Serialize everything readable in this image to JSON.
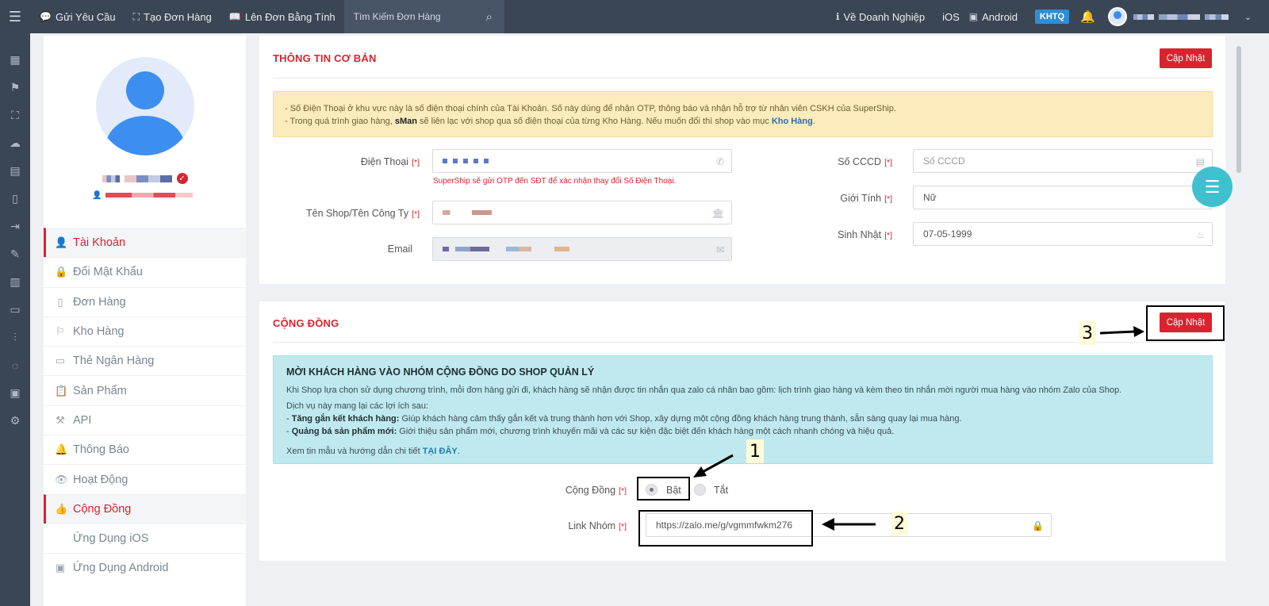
{
  "topbar": {
    "links": [
      {
        "icon": "chat-icon",
        "label": "Gửi Yêu Cầu"
      },
      {
        "icon": "scan-icon",
        "label": "Tạo Đơn Hàng"
      },
      {
        "icon": "book-icon",
        "label": "Lên Đơn Bằng Tính"
      }
    ],
    "search_placeholder": "Tìm Kiếm Đơn Hàng",
    "right_links": [
      {
        "icon": "info-icon",
        "label": "Về Doanh Nghiệp"
      },
      {
        "icon": "apple-icon",
        "label": "iOS"
      },
      {
        "icon": "android-icon",
        "label": "Android"
      }
    ],
    "badge": "KHTQ"
  },
  "sidebar": {
    "items": [
      {
        "icon": "user-icon",
        "label": "Tài Khoản",
        "active": true
      },
      {
        "icon": "lock-icon",
        "label": "Đổi Mật Khẩu"
      },
      {
        "icon": "book-icon",
        "label": "Đơn Hàng"
      },
      {
        "icon": "signpost-icon",
        "label": "Kho Hàng"
      },
      {
        "icon": "card-icon",
        "label": "Thẻ Ngân Hàng"
      },
      {
        "icon": "clipboard-icon",
        "label": "Sản Phẩm"
      },
      {
        "icon": "wand-icon",
        "label": "API"
      },
      {
        "icon": "bell-icon",
        "label": "Thông Báo"
      },
      {
        "icon": "eye-icon",
        "label": "Hoạt Động"
      },
      {
        "icon": "thumbs-up-icon",
        "label": "Cộng Đồng",
        "active": true
      },
      {
        "icon": "apple-icon",
        "label": "Ứng Dụng iOS"
      },
      {
        "icon": "android-icon",
        "label": "Ứng Dụng Android"
      }
    ]
  },
  "basic": {
    "title": "THÔNG TIN CƠ BẢN",
    "update_label": "Cập Nhật",
    "notice_line1": "- Số Điện Thoại ở khu vực này là số điện thoại chính của Tài Khoản. Số này dùng để nhận OTP, thông báo và nhận hỗ trợ từ nhân viên CSKH của SuperShip.",
    "notice_line2_a": "- Trong quá trình giao hàng, ",
    "notice_line2_b": "sMan",
    "notice_line2_c": " sẽ liên lạc với shop qua số điện thoại của từng Kho Hàng. Nếu muốn đổi thì shop vào mục ",
    "notice_line2_link": "Kho Hàng",
    "notice_line2_end": ".",
    "phone_label": "Điện Thoại",
    "phone_hint": "SuperShip sẽ gửi OTP đến SĐT để xác nhận thay đổi Số Điện Thoại.",
    "shop_label": "Tên Shop/Tên Công Ty",
    "email_label": "Email",
    "cccd_label": "Số CCCD",
    "cccd_placeholder": "Số CCCD",
    "gender_label": "Giới Tính",
    "gender_value": "Nữ",
    "birthday_label": "Sinh Nhật",
    "birthday_value": "07-05-1999",
    "required_mark": "[*]"
  },
  "community": {
    "title": "CỘNG ĐỒNG",
    "update_label": "Cập Nhật",
    "info_heading": "MỜI KHÁCH HÀNG VÀO NHÓM CỘNG ĐỒNG DO SHOP QUẢN LÝ",
    "info_p1": "Khi Shop lựa chọn sử dụng chương trình, mỗi đơn hàng gửi đi, khách hàng sẽ nhận được tin nhắn qua zalo cá nhân bao gồm: lịch trình giao hàng và kèm theo tin nhắn mời người mua hàng vào nhóm Zalo của Shop.",
    "info_p2": "Dịch vụ này mang lại các lợi ích sau:",
    "benefit1_title": "Tăng gắn kết khách hàng:",
    "benefit1_text": " Giúp khách hàng cảm thấy gắn kết và trung thành hơn với Shop, xây dựng một cộng đồng khách hàng trung thành, sẵn sàng quay lại mua hàng.",
    "benefit2_title": "Quảng bá sản phẩm mới:",
    "benefit2_text": " Giới thiệu sản phẩm mới, chương trình khuyến mãi và các sự kiện đặc biệt đến khách hàng một cách nhanh chóng và hiệu quả.",
    "info_more": "Xem tin mẫu và hướng dẫn chi tiết ",
    "info_more_link": "TẠI ĐÂY",
    "info_more_end": ".",
    "community_label": "Cộng Đồng",
    "option_on": "Bật",
    "option_off": "Tắt",
    "selected": "Bật",
    "link_label": "Link Nhóm",
    "link_value": "https://zalo.me/g/vgmmfwkm276",
    "required_mark": "[*]"
  },
  "annotations": {
    "step1": "1",
    "step2": "2",
    "step3": "3"
  }
}
